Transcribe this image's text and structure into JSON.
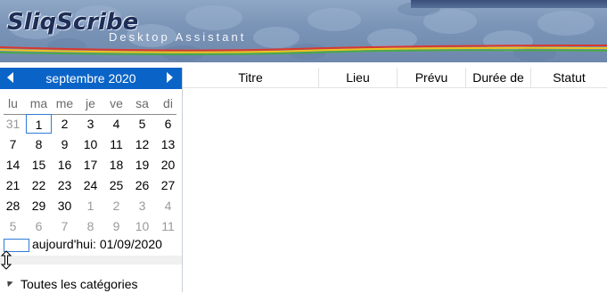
{
  "app": {
    "logo_text": "SliqScribe",
    "tagline": "Desktop Assistant"
  },
  "calendar": {
    "month_label": "septembre 2020",
    "weekdays": [
      "lu",
      "ma",
      "me",
      "je",
      "ve",
      "sa",
      "di"
    ],
    "weeks": [
      [
        "31",
        "1",
        "2",
        "3",
        "4",
        "5",
        "6"
      ],
      [
        "7",
        "8",
        "9",
        "10",
        "11",
        "12",
        "13"
      ],
      [
        "14",
        "15",
        "16",
        "17",
        "18",
        "19",
        "20"
      ],
      [
        "21",
        "22",
        "23",
        "24",
        "25",
        "26",
        "27"
      ],
      [
        "28",
        "29",
        "30",
        "1",
        "2",
        "3",
        "4"
      ],
      [
        "5",
        "6",
        "7",
        "8",
        "9",
        "10",
        "11"
      ]
    ],
    "today_label": "aujourd'hui: 01/09/2020"
  },
  "categories": {
    "all_label": "Toutes les catégories"
  },
  "list": {
    "columns": [
      "Titre",
      "Lieu",
      "Prévu",
      "Durée de",
      "Statut"
    ]
  },
  "colors": {
    "calendar_header": "#0a64c8",
    "selection_border": "#2f7bd6"
  }
}
